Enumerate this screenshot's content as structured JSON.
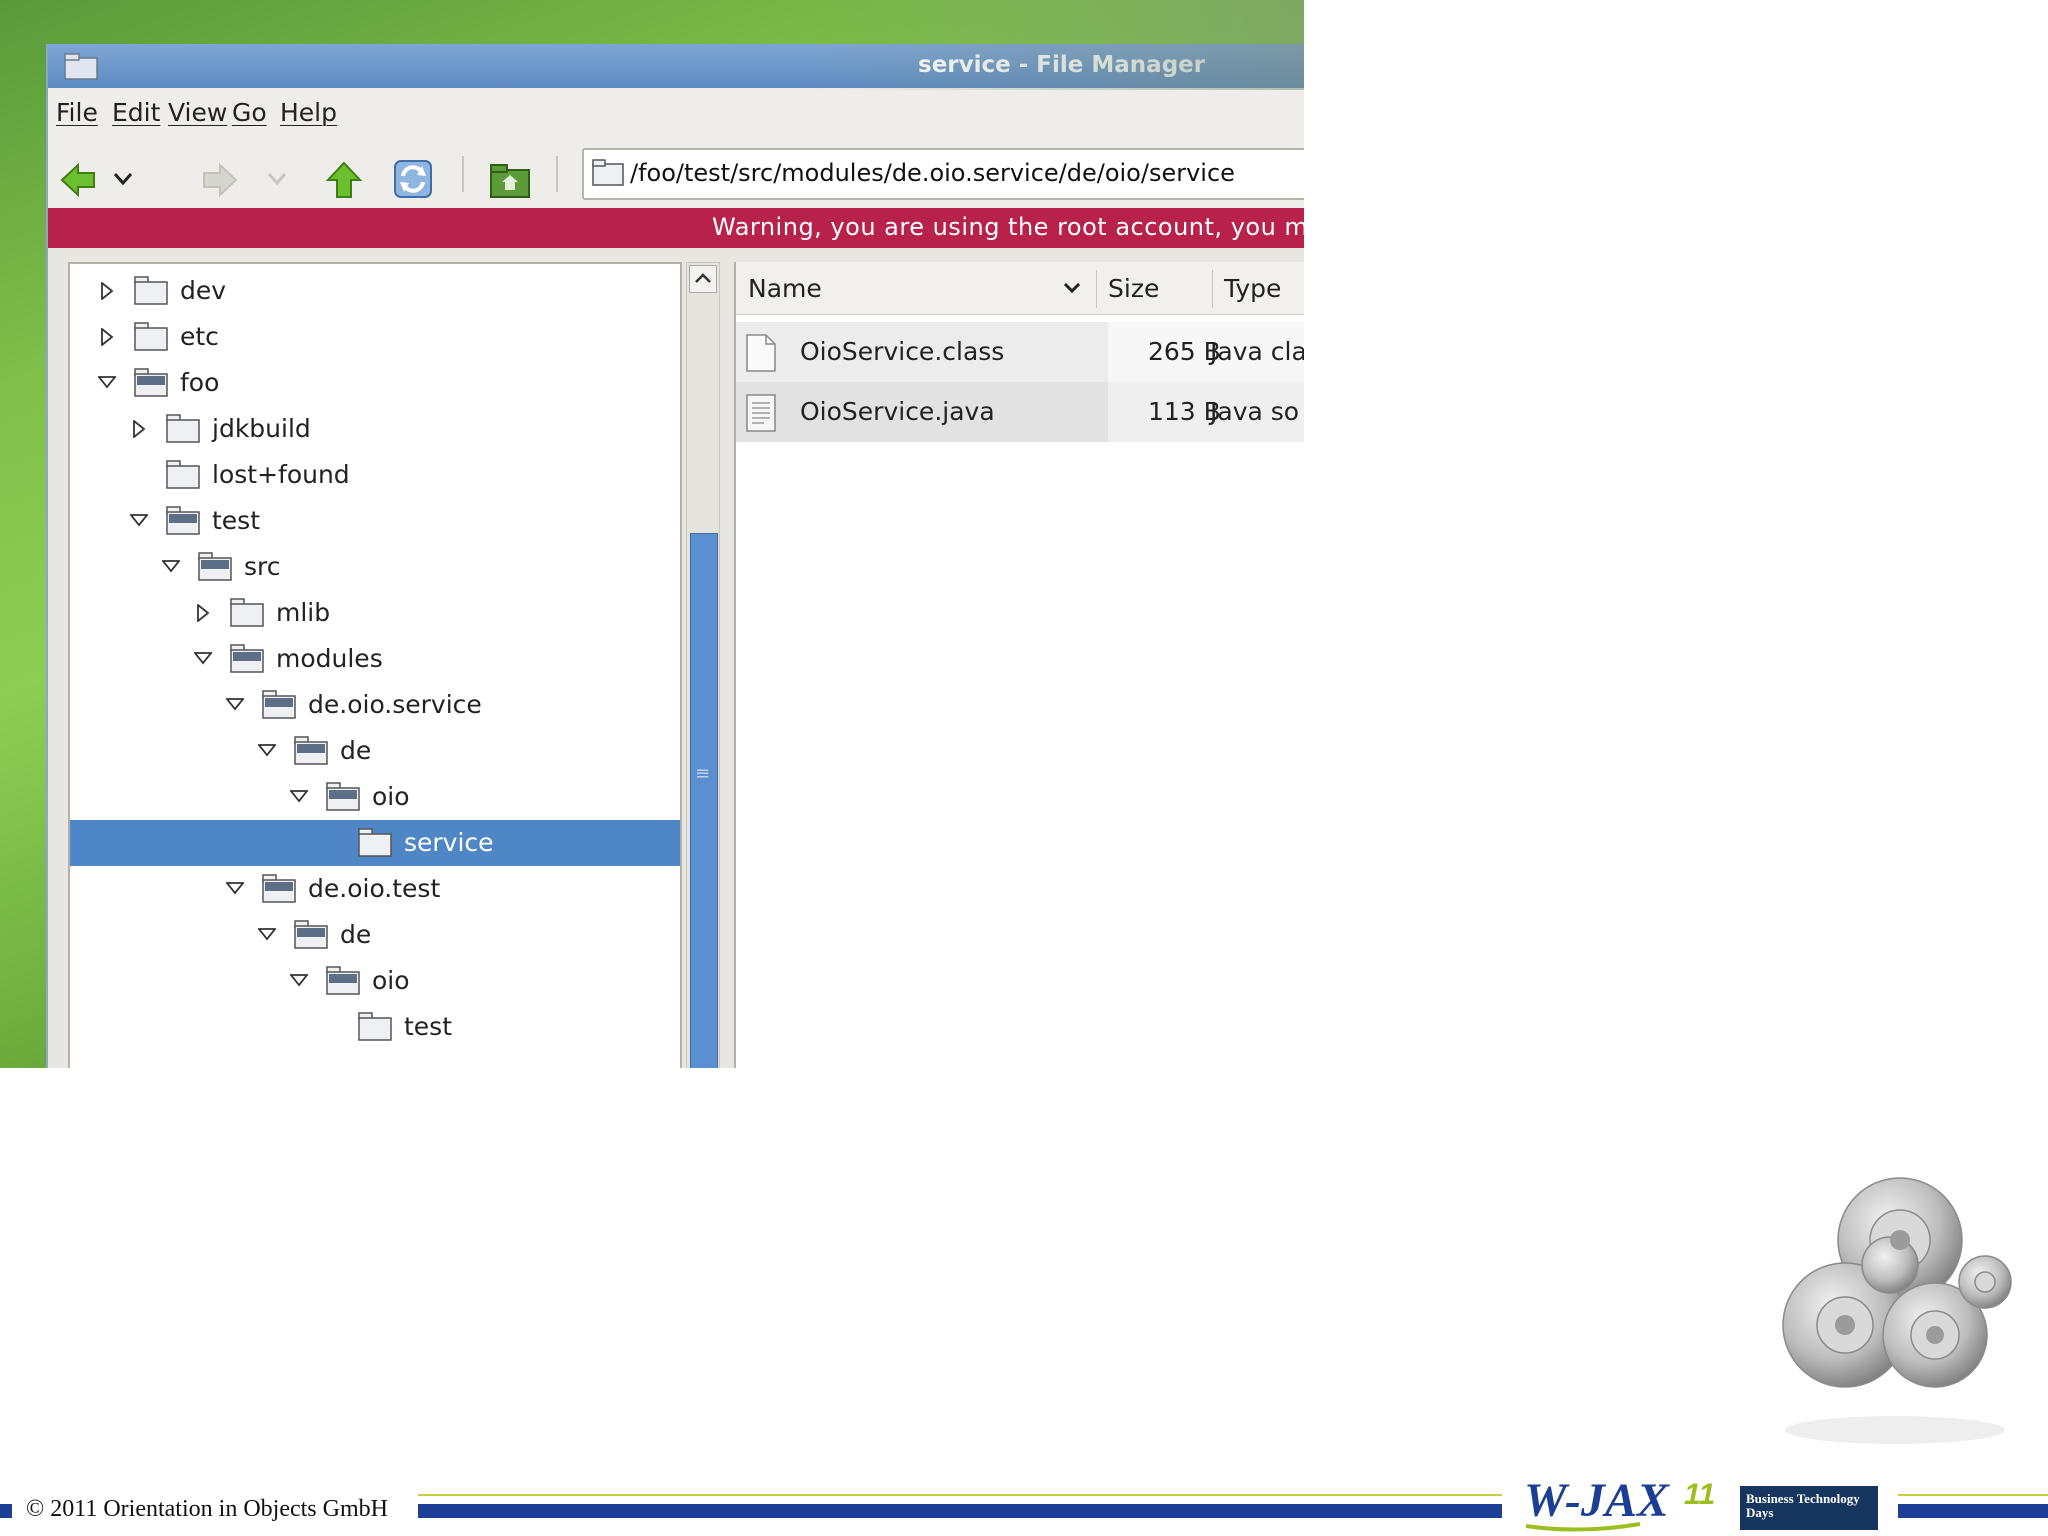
{
  "window": {
    "title": "service - File Manager"
  },
  "menubar": {
    "items": [
      "File",
      "Edit",
      "View",
      "Go",
      "Help"
    ]
  },
  "toolbar": {
    "back": "back-arrow",
    "forward": "forward-arrow",
    "up": "up-arrow",
    "reload": "reload",
    "home": "home"
  },
  "address": {
    "path": "/foo/test/src/modules/de.oio.service/de/oio/service"
  },
  "warning": {
    "text": "Warning, you are using the root account, you may h"
  },
  "tree": {
    "items": [
      {
        "label": "dev",
        "depth": 0,
        "state": "collapsed"
      },
      {
        "label": "etc",
        "depth": 0,
        "state": "collapsed"
      },
      {
        "label": "foo",
        "depth": 0,
        "state": "expanded"
      },
      {
        "label": "jdkbuild",
        "depth": 1,
        "state": "collapsed"
      },
      {
        "label": "lost+found",
        "depth": 1,
        "state": "leaf"
      },
      {
        "label": "test",
        "depth": 1,
        "state": "expanded"
      },
      {
        "label": "src",
        "depth": 2,
        "state": "expanded"
      },
      {
        "label": "mlib",
        "depth": 3,
        "state": "collapsed"
      },
      {
        "label": "modules",
        "depth": 3,
        "state": "expanded"
      },
      {
        "label": "de.oio.service",
        "depth": 4,
        "state": "expanded"
      },
      {
        "label": "de",
        "depth": 5,
        "state": "expanded"
      },
      {
        "label": "oio",
        "depth": 6,
        "state": "expanded"
      },
      {
        "label": "service",
        "depth": 7,
        "state": "leaf",
        "selected": true
      },
      {
        "label": "de.oio.test",
        "depth": 4,
        "state": "expanded"
      },
      {
        "label": "de",
        "depth": 5,
        "state": "expanded"
      },
      {
        "label": "oio",
        "depth": 6,
        "state": "expanded"
      },
      {
        "label": "test",
        "depth": 7,
        "state": "leaf"
      }
    ]
  },
  "filelist": {
    "columns": [
      "Name",
      "Size",
      "Type"
    ],
    "rows": [
      {
        "name": "OioService.class",
        "size": "265 B",
        "type": "Java cla"
      },
      {
        "name": "OioService.java",
        "size": "113 B",
        "type": "Java so"
      }
    ]
  },
  "footer": {
    "copyright": "© 2011 Orientation in Objects GmbH",
    "logo_text": "W-JAX",
    "logo_suffix": "11",
    "badge_text": "Business Technology Days"
  },
  "colors": {
    "selection": "#4f86c6",
    "warning_bar": "#b8224a",
    "titlebar": "#6a96cb",
    "footer_blue": "#1c3f95"
  }
}
